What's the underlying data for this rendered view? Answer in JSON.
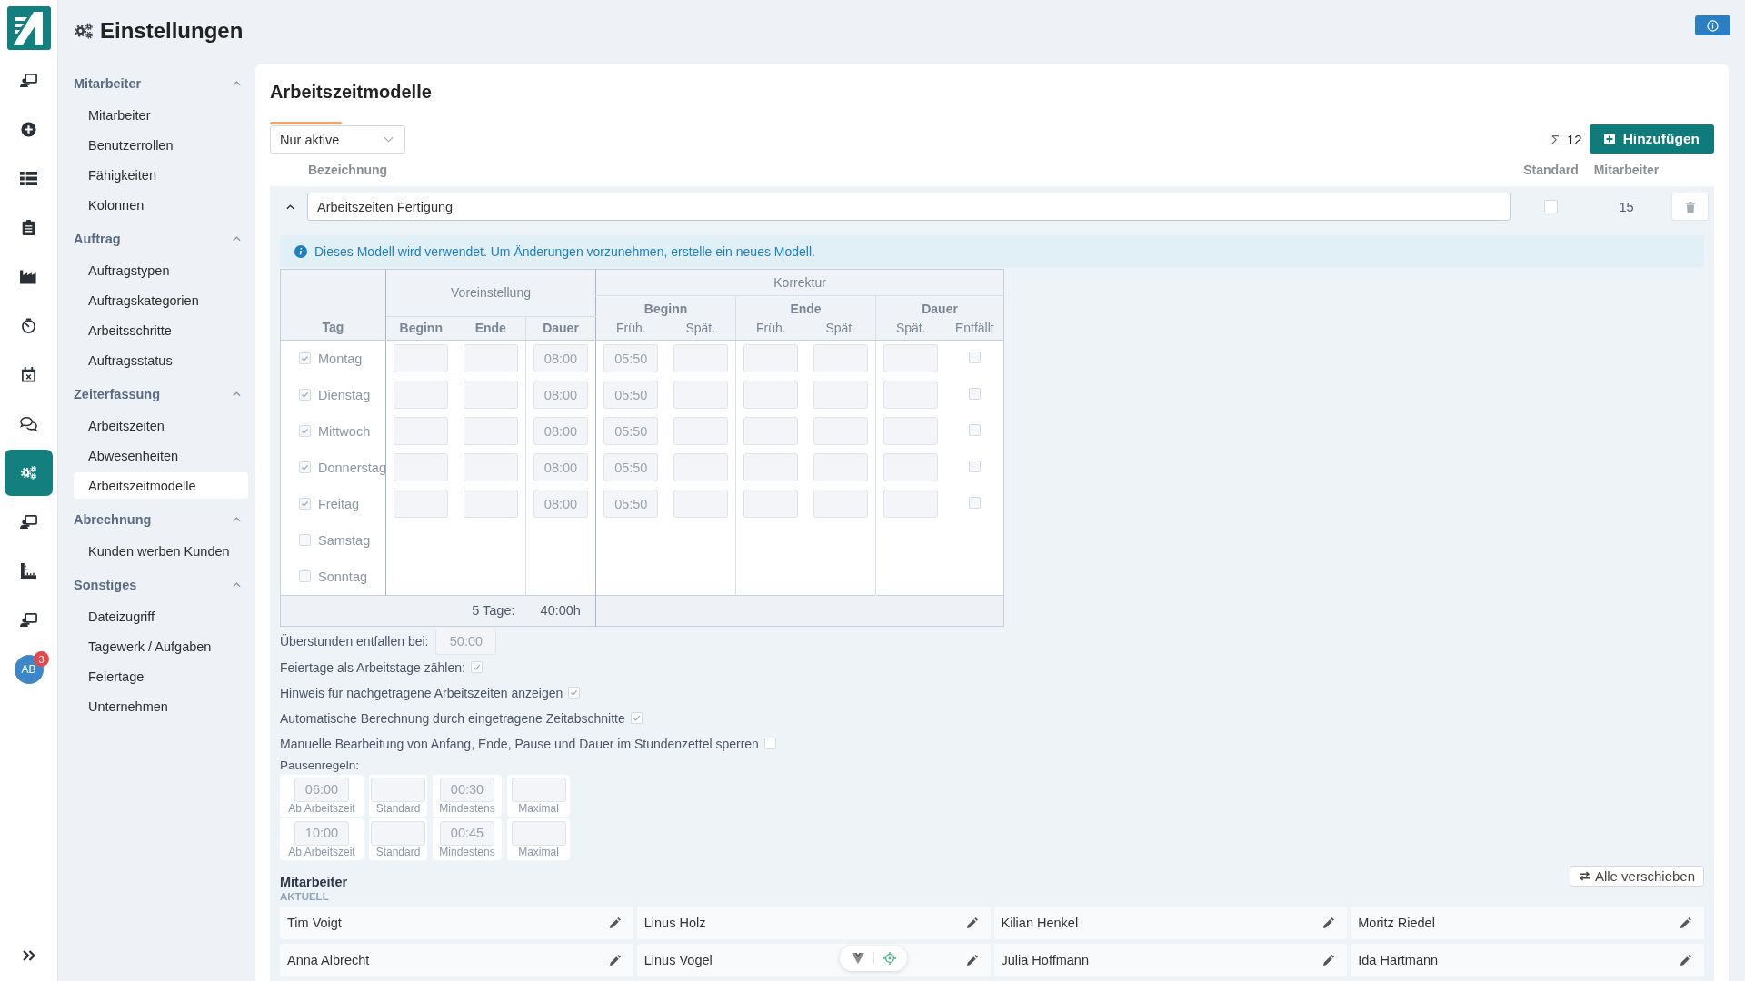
{
  "rail": {
    "items": [
      {
        "selected": false
      },
      {
        "selected": false
      },
      {
        "selected": false
      },
      {
        "selected": false
      },
      {
        "selected": false
      },
      {
        "selected": false
      },
      {
        "selected": false
      },
      {
        "selected": false
      },
      {
        "selected": true
      },
      {
        "selected": false
      },
      {
        "selected": false
      },
      {
        "selected": false
      }
    ],
    "avatar": {
      "initials": "AB",
      "badge": "3"
    }
  },
  "sidebar": {
    "title": "Einstellungen",
    "groups": [
      {
        "title": "Mitarbeiter",
        "expanded": true,
        "items": [
          {
            "label": "Mitarbeiter",
            "selected": false
          },
          {
            "label": "Benutzerrollen",
            "selected": false
          },
          {
            "label": "Fähigkeiten",
            "selected": false
          },
          {
            "label": "Kolonnen",
            "selected": false
          }
        ]
      },
      {
        "title": "Auftrag",
        "expanded": true,
        "items": [
          {
            "label": "Auftragstypen",
            "selected": false
          },
          {
            "label": "Auftragskategorien",
            "selected": false
          },
          {
            "label": "Arbeitsschritte",
            "selected": false
          },
          {
            "label": "Auftragsstatus",
            "selected": false
          }
        ]
      },
      {
        "title": "Zeiterfassung",
        "expanded": true,
        "items": [
          {
            "label": "Arbeitszeiten",
            "selected": false
          },
          {
            "label": "Abwesenheiten",
            "selected": false
          },
          {
            "label": "Arbeitszeitmodelle",
            "selected": true
          }
        ]
      },
      {
        "title": "Abrechnung",
        "expanded": true,
        "items": [
          {
            "label": "Kunden werben Kunden",
            "selected": false
          }
        ]
      },
      {
        "title": "Sonstiges",
        "expanded": true,
        "items": [
          {
            "label": "Dateizugriff",
            "selected": false
          },
          {
            "label": "Tagewerk / Aufgaben",
            "selected": false
          },
          {
            "label": "Feiertage",
            "selected": false
          },
          {
            "label": "Unternehmen",
            "selected": false
          }
        ]
      }
    ]
  },
  "panel": {
    "title": "Arbeitszeitmodelle",
    "filter": "Nur aktive",
    "total_symbol": "Σ",
    "total": "12",
    "add_button": "Hinzufügen",
    "columns": [
      "Bezeichnung",
      "Standard",
      "Mitarbeiter"
    ],
    "models": [
      {
        "name": "Arbeitszeiten Fertigung",
        "expanded": true,
        "standard": false,
        "employees": "15",
        "notice": "Dieses Modell wird verwendet. Um Änderungen vorzunehmen, erstelle ein neues Modell.",
        "schedule": {
          "day_header": "Tag",
          "preset_header": "Voreinstellung",
          "preset_columns": [
            "Beginn",
            "Ende",
            "Dauer"
          ],
          "correction_header": "Korrektur",
          "correction_groups": [
            {
              "label": "Beginn",
              "columns": [
                "Früh.",
                "Spät."
              ]
            },
            {
              "label": "Ende",
              "columns": [
                "Früh.",
                "Spät."
              ]
            },
            {
              "label": "Dauer",
              "columns": [
                "Spät.",
                "Entfällt"
              ]
            }
          ],
          "days": [
            {
              "name": "Montag",
              "checked": true,
              "duration": "08:00",
              "begin_early": "05:50",
              "dropped": false
            },
            {
              "name": "Dienstag",
              "checked": true,
              "duration": "08:00",
              "begin_early": "05:50",
              "dropped": false
            },
            {
              "name": "Mittwoch",
              "checked": true,
              "duration": "08:00",
              "begin_early": "05:50",
              "dropped": false
            },
            {
              "name": "Donnerstag",
              "checked": true,
              "duration": "08:00",
              "begin_early": "05:50",
              "dropped": false
            },
            {
              "name": "Freitag",
              "checked": true,
              "duration": "08:00",
              "begin_early": "05:50",
              "dropped": false
            },
            {
              "name": "Samstag",
              "checked": false
            },
            {
              "name": "Sonntag",
              "checked": false
            }
          ],
          "footer": {
            "label": "5 Tage:",
            "total": "40:00h"
          }
        },
        "overtime": {
          "label": "Überstunden entfallen bei:",
          "value": "50:00"
        },
        "options": [
          {
            "label": "Feiertage als Arbeitstage zählen:",
            "checked": true
          },
          {
            "label": "Hinweis für nachgetragene Arbeitszeiten anzeigen",
            "checked": true
          },
          {
            "label": "Automatische Berechnung durch eingetragene Zeitabschnitte",
            "checked": true
          },
          {
            "label": "Manuelle Bearbeitung von Anfang, Ende, Pause und Dauer im Stundenzettel sperren",
            "checked": false
          }
        ],
        "pause_rules": {
          "label": "Pausenregeln:",
          "rows": [
            {
              "fields": [
                {
                  "label": "Ab Arbeitszeit",
                  "value": "06:00"
                },
                {
                  "label": "Standard"
                },
                {
                  "label": "Mindestens",
                  "value": "00:30"
                },
                {
                  "label": "Maximal"
                }
              ]
            },
            {
              "fields": [
                {
                  "label": "Ab Arbeitszeit",
                  "value": "10:00"
                },
                {
                  "label": "Standard"
                },
                {
                  "label": "Mindestens",
                  "value": "00:45"
                },
                {
                  "label": "Maximal"
                }
              ]
            }
          ]
        },
        "staff": {
          "title": "Mitarbeiter",
          "subtitle": "AKTUELL",
          "move_button": "Alle verschieben",
          "names": [
            "Tim Voigt",
            "Linus Holz",
            "Kilian Henkel",
            "Moritz Riedel",
            "Anna Albrecht",
            "Linus Vogel",
            "Julia Hoffmann",
            "Ida Hartmann"
          ]
        }
      }
    ]
  }
}
